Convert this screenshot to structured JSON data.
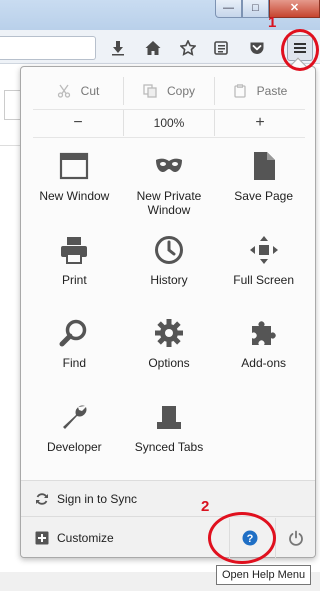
{
  "window": {
    "controls": {
      "minimize": "—",
      "maximize": "□",
      "close": "✕"
    }
  },
  "toolbar": {
    "icons": [
      "download-icon",
      "home-icon",
      "bookmark-star-icon",
      "reading-list-icon",
      "pocket-icon",
      "hamburger-menu-icon"
    ]
  },
  "menu": {
    "edit": {
      "cut": "Cut",
      "copy": "Copy",
      "paste": "Paste"
    },
    "zoom": {
      "minus": "−",
      "level": "100%",
      "plus": "+"
    },
    "items": [
      {
        "label": "New Window",
        "icon": "new-window-icon"
      },
      {
        "label": "New Private Window",
        "icon": "private-mask-icon"
      },
      {
        "label": "Save Page",
        "icon": "save-page-icon"
      },
      {
        "label": "Print",
        "icon": "printer-icon"
      },
      {
        "label": "History",
        "icon": "clock-icon"
      },
      {
        "label": "Full Screen",
        "icon": "full-screen-icon"
      },
      {
        "label": "Find",
        "icon": "magnifier-icon"
      },
      {
        "label": "Options",
        "icon": "gear-icon"
      },
      {
        "label": "Add-ons",
        "icon": "puzzle-piece-icon"
      },
      {
        "label": "Developer",
        "icon": "wrench-icon"
      },
      {
        "label": "Synced Tabs",
        "icon": "synced-tabs-icon"
      }
    ],
    "footer": {
      "sync": "Sign in to Sync",
      "customize": "Customize"
    }
  },
  "tooltip": {
    "text": "Open Help Menu"
  },
  "annotations": {
    "first": "1",
    "second": "2"
  },
  "colors": {
    "annotation": "#e0101e",
    "help_accent": "#1f6fc5",
    "icon_gray": "#555555"
  }
}
